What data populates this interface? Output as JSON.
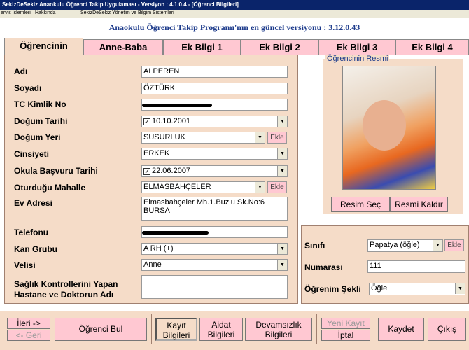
{
  "window": {
    "title": "SekizDeSekiz Anaokulu Öğrenci Takip Uygulaması - Versiyon : 4.1.0.4 - [Öğrenci Bilgileri]"
  },
  "menu": [
    {
      "label": "ervis İşlemleri"
    },
    {
      "label": "Hakkında"
    },
    {
      "label": "SekizDeSekiz Yönetim ve Bilgim Sistemleri"
    }
  ],
  "banner": "Anaokulu Öğrenci Takip Programı'nın en güncel versiyonu : 3.12.0.43",
  "tabs": [
    "Öğrencinin",
    "Anne-Baba",
    "Ek Bilgi 1",
    "Ek Bilgi 2",
    "Ek Bilgi 3",
    "Ek Bilgi 4"
  ],
  "form": {
    "adi": {
      "label": "Adı",
      "value": "ALPEREN"
    },
    "soyadi": {
      "label": "Soyadı",
      "value": "ÖZTÜRK"
    },
    "tc": {
      "label": "TC Kimlik No",
      "value": ""
    },
    "dogum_tarihi": {
      "label": "Doğum Tarihi",
      "value": "10.10.2001",
      "checked": "✓"
    },
    "dogum_yeri": {
      "label": "Doğum Yeri",
      "value": "SUSURLUK",
      "add": "Ekle"
    },
    "cinsiyet": {
      "label": "Cinsiyeti",
      "value": "ERKEK"
    },
    "basvuru": {
      "label": "Okula Başvuru Tarihi",
      "value": "22.06.2007",
      "checked": "✓"
    },
    "mahalle": {
      "label": "Oturduğu Mahalle",
      "value": "ELMASBAHÇELER",
      "add": "Ekle"
    },
    "adres": {
      "label": "Ev Adresi",
      "line1": "Elmasbahçeler Mh.1.Buzlu Sk.No:6",
      "line2": "BURSA"
    },
    "telefon": {
      "label": "Telefonu",
      "value": ""
    },
    "kan": {
      "label": "Kan Grubu",
      "value": "A RH (+)"
    },
    "veli": {
      "label": "Velisi",
      "value": "Anne"
    },
    "saglik": {
      "label1": "Sağlık Kontrollerini Yapan",
      "label2": "Hastane ve Doktorun Adı",
      "value": ""
    }
  },
  "photo": {
    "legend": "Öğrencinin Resmi",
    "select": "Resim Seç",
    "remove": "Resmi Kaldır"
  },
  "side": {
    "sinif": {
      "label": "Sınıfı",
      "value": "Papatya (öğle)",
      "add": "Ekle"
    },
    "numara": {
      "label": "Numarası",
      "value": "111"
    },
    "sekil": {
      "label": "Öğrenim Şekli",
      "value": "Öğle"
    }
  },
  "bottom": {
    "ileri": "İleri ->",
    "geri": "<- Geri",
    "bul": "Öğrenci Bul",
    "kayit1": "Kayıt",
    "kayit2": "Bilgileri",
    "aidat1": "Aidat",
    "aidat2": "Bilgileri",
    "devam1": "Devamsızlık",
    "devam2": "Bilgileri",
    "yeni": "Yeni Kayıt",
    "iptal": "İptal",
    "kaydet": "Kaydet",
    "cikis": "Çıkış"
  },
  "colors": {
    "accent": "#1e3c8c",
    "panel": "#f5dcc8",
    "button": "#ffc8d2",
    "titlebar": "#0a246a"
  }
}
